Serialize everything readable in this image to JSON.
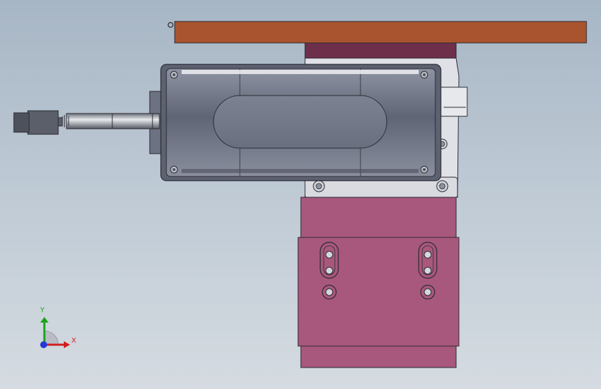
{
  "viewport": {
    "background_top": "#a7b6c5",
    "background_bottom": "#d5dbe1"
  },
  "model": {
    "top_plate_color": "#a9542e",
    "upper_block_color": "#6e2f4b",
    "motor_body_color": "#757a8a",
    "mount_block_color": "#a8587c",
    "bracket_color": "#dfe1e6",
    "edge_color": "#2a2a32"
  },
  "triad": {
    "y_label": "Y",
    "x_label": "X",
    "y_color": "#1aa31a",
    "x_color": "#d01e1e",
    "z_color": "#2438d6"
  }
}
